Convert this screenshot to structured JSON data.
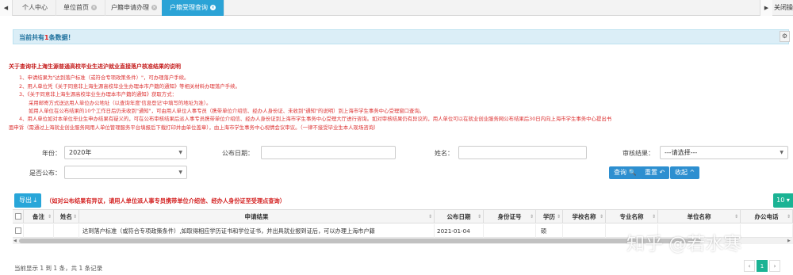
{
  "tabs": [
    {
      "label": "个人中心",
      "closable": false
    },
    {
      "label": "单位首页",
      "closable": true
    },
    {
      "label": "户籍申请办理",
      "closable": true
    },
    {
      "label": "户籍受理查询",
      "closable": true,
      "active": true
    }
  ],
  "tabbar": {
    "close_label": "关闭操"
  },
  "info": {
    "prefix": "当前共有",
    "count": "1",
    "suffix": "条数据！"
  },
  "notice": {
    "title": "关于查询非上海生源普通高校毕业生进沪就业直接落户核准结果的说明",
    "lines": [
      "1、申请结果为\"达到落户标准（或符合专项政策条件）\"，可办理落户手续。",
      "2、用人单位凭《关于同意非上海生源高校毕业生办理本市户籍的通知》等相关材料办理落户手续。",
      "3、《关于同意非上海生源高校毕业生办理本市户籍的通知》获取方式：",
      "采用邮寄方式送达用人单位办公地址（以查询年度'信息登记'中填写的地址为准）。",
      "如用人单位在公布结果的10个工作日后仍未收到\"通知\"，可由用人单位人事专员（携带单位介绍信、经办人身份证、未收到\"通知\"的说明）到上海市学生事务中心受理窗口查询。",
      "4、用人单位如对本单位毕业生申办结果有疑义的，可在公布审核结果后派人事专员携带单位介绍信、经办人身份证到上海市学生事务中心受理大厅进行咨询。如对审核结果仍有异议的，用人单位可以在就业创业服务网公布结果后30日内向上海市学生事务中心提出书",
      "面申诉（需通过上海就业创业服务网用人单位管理服务平台填报后下载打印并由单位盖章），由上海市学生事务中心视情会议审议。（一律不接受毕业生本人现场咨询）"
    ]
  },
  "form": {
    "year_label": "年份：",
    "year_value": "2020年",
    "publish_date_label": "公布日期：",
    "name_label": "姓名：",
    "review_result_label": "审核结果：",
    "review_result_value": "---请选择---",
    "is_public_label": "是否公布：",
    "query_button": "查询",
    "reset_button": "重置",
    "collapse_button": "收起"
  },
  "toolbar": {
    "export_label": "导出",
    "note": "（如对公布结果有异议，请用人单位派人事专员携带单位介绍信、经办人身份证至受理点查询）",
    "page_size": "10"
  },
  "table": {
    "columns": [
      "备注",
      "姓名",
      "申请结果",
      "公布日期",
      "身份证号",
      "学历",
      "学校名称",
      "专业名称",
      "单位名称",
      "办公电话"
    ],
    "rows": [
      {
        "remark": "",
        "name": "",
        "result": "达到落户标准（或符合专项政策条件）,如取得相应学历证书和学位证书，并出具就业报到证后，可以办理上海市户籍",
        "date": "2021-01-04",
        "id_number": "",
        "education": "硕",
        "school": "",
        "major": "",
        "unit": "",
        "phone": ""
      }
    ]
  },
  "footer": {
    "summary": "当前显示 1 到 1 条，共 1 条记录",
    "current_page": "1"
  },
  "watermark": "知乎 @若水寒"
}
